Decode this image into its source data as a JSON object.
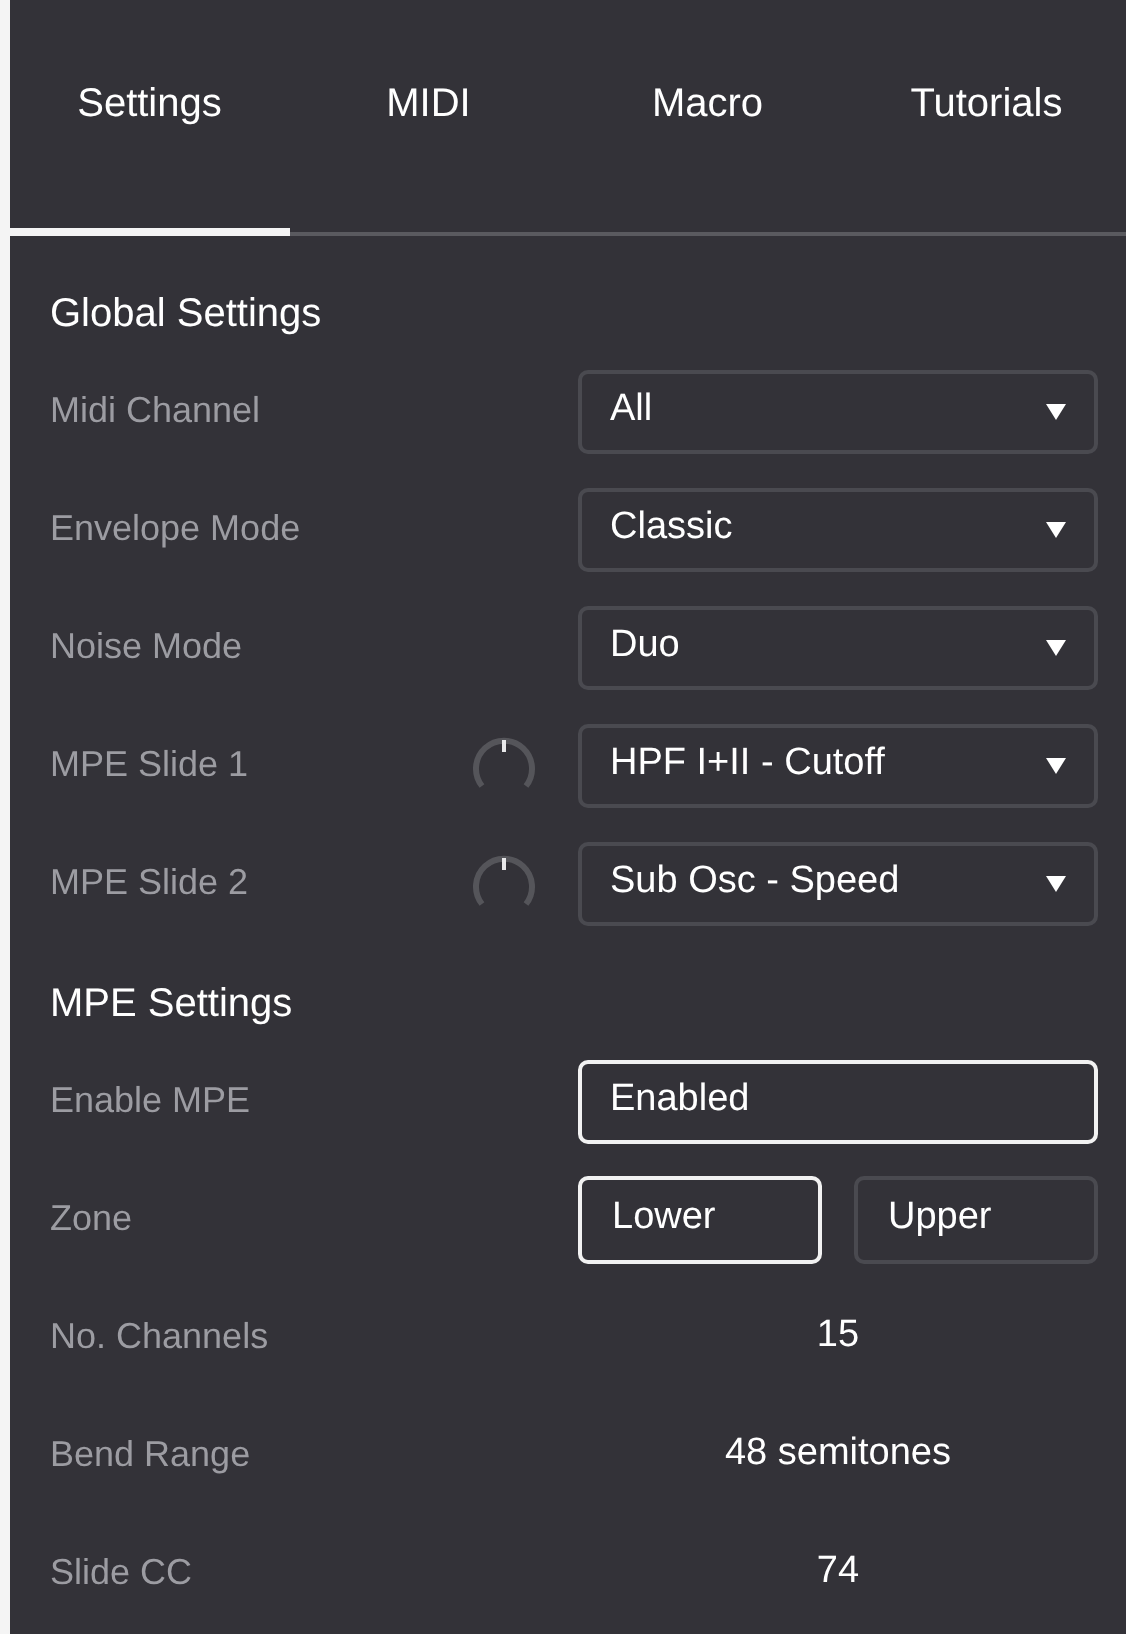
{
  "tabs": [
    {
      "label": "Settings",
      "selected": true
    },
    {
      "label": "MIDI",
      "selected": false
    },
    {
      "label": "Macro",
      "selected": false
    },
    {
      "label": "Tutorials",
      "selected": false
    }
  ],
  "sections": [
    {
      "title": "Global Settings",
      "rows": [
        {
          "kind": "dropdown",
          "label": "Midi Channel",
          "value": "All"
        },
        {
          "kind": "dropdown",
          "label": "Envelope Mode",
          "value": "Classic"
        },
        {
          "kind": "dropdown",
          "label": "Noise Mode",
          "value": "Duo"
        },
        {
          "kind": "knob-dropdown",
          "label": "MPE Slide 1",
          "value": "HPF I+II - Cutoff"
        },
        {
          "kind": "knob-dropdown",
          "label": "MPE Slide 2",
          "value": "Sub Osc - Speed"
        }
      ]
    },
    {
      "title": "MPE Settings",
      "rows": [
        {
          "kind": "toggle",
          "label": "Enable MPE",
          "value": "Enabled",
          "on": true
        },
        {
          "kind": "segmented",
          "label": "Zone",
          "options": [
            {
              "label": "Lower",
              "selected": true
            },
            {
              "label": "Upper",
              "selected": false
            }
          ]
        },
        {
          "kind": "value",
          "label": "No. Channels",
          "value": "15"
        },
        {
          "kind": "value",
          "label": "Bend Range",
          "value": "48 semitones"
        },
        {
          "kind": "value",
          "label": "Slide CC",
          "value": "74"
        }
      ]
    }
  ]
}
